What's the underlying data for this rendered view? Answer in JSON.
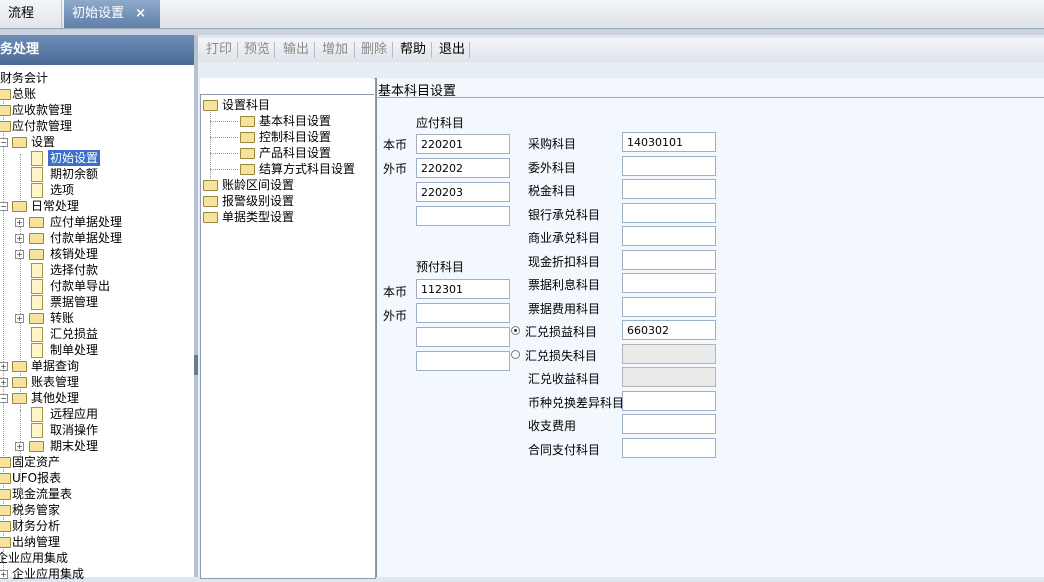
{
  "tabs": [
    {
      "label": "流程"
    },
    {
      "label": "初始设置",
      "close": "×"
    }
  ],
  "left_panel": {
    "header": "务处理",
    "items": [
      {
        "label": "财务会计"
      },
      {
        "label": "总账"
      },
      {
        "label": "应收款管理"
      },
      {
        "label": "应付款管理"
      },
      {
        "label": "设置"
      },
      {
        "label": "初始设置"
      },
      {
        "label": "期初余额"
      },
      {
        "label": "选项"
      },
      {
        "label": "日常处理"
      },
      {
        "label": "应付单据处理"
      },
      {
        "label": "付款单据处理"
      },
      {
        "label": "核销处理"
      },
      {
        "label": "选择付款"
      },
      {
        "label": "付款单导出"
      },
      {
        "label": "票据管理"
      },
      {
        "label": "转账"
      },
      {
        "label": "汇兑损益"
      },
      {
        "label": "制单处理"
      },
      {
        "label": "单据查询"
      },
      {
        "label": "账表管理"
      },
      {
        "label": "其他处理"
      },
      {
        "label": "远程应用"
      },
      {
        "label": "取消操作"
      },
      {
        "label": "期末处理"
      },
      {
        "label": "固定资产"
      },
      {
        "label": "UFO报表"
      },
      {
        "label": "现金流量表"
      },
      {
        "label": "税务管家"
      },
      {
        "label": "财务分析"
      },
      {
        "label": "出纳管理"
      },
      {
        "label": "企业应用集成"
      },
      {
        "label": "企业应用集成"
      }
    ]
  },
  "toolbar": {
    "print": "打印",
    "preview": "预览",
    "export": "输出",
    "add": "增加",
    "delete": "删除",
    "help": "帮助",
    "exit": "退出"
  },
  "settings_tree": {
    "items": [
      {
        "label": "设置科目"
      },
      {
        "label": "基本科目设置"
      },
      {
        "label": "控制科目设置"
      },
      {
        "label": "产品科目设置"
      },
      {
        "label": "结算方式科目设置"
      },
      {
        "label": "账龄区间设置"
      },
      {
        "label": "报警级别设置"
      },
      {
        "label": "单据类型设置"
      }
    ]
  },
  "form": {
    "title": "基本科目设置",
    "payable": {
      "heading": "应付科目",
      "local_label": "本币",
      "foreign_label": "外币",
      "values": [
        "220201",
        "220202",
        "220203",
        ""
      ]
    },
    "prepaid": {
      "heading": "预付科目",
      "local_label": "本币",
      "foreign_label": "外币",
      "values": [
        "112301",
        "",
        "",
        ""
      ]
    },
    "right_fields": [
      {
        "label": "采购科目",
        "value": "14030101"
      },
      {
        "label": "委外科目",
        "value": ""
      },
      {
        "label": "税金科目",
        "value": ""
      },
      {
        "label": "银行承兑科目",
        "value": ""
      },
      {
        "label": "商业承兑科目",
        "value": ""
      },
      {
        "label": "现金折扣科目",
        "value": ""
      },
      {
        "label": "票据利息科目",
        "value": ""
      },
      {
        "label": "票据费用科目",
        "value": ""
      },
      {
        "label": "汇兑损益科目",
        "value": "660302"
      },
      {
        "label": "汇兑损失科目",
        "value": ""
      },
      {
        "label": "汇兑收益科目",
        "value": ""
      },
      {
        "label": "币种兑换差异科目",
        "value": ""
      },
      {
        "label": "收支费用",
        "value": ""
      },
      {
        "label": "合同支付科目",
        "value": ""
      }
    ]
  },
  "colors": {
    "accent": "#3b6fc9",
    "header": "#4a6a96",
    "form_bg": "#f2f8fd"
  }
}
